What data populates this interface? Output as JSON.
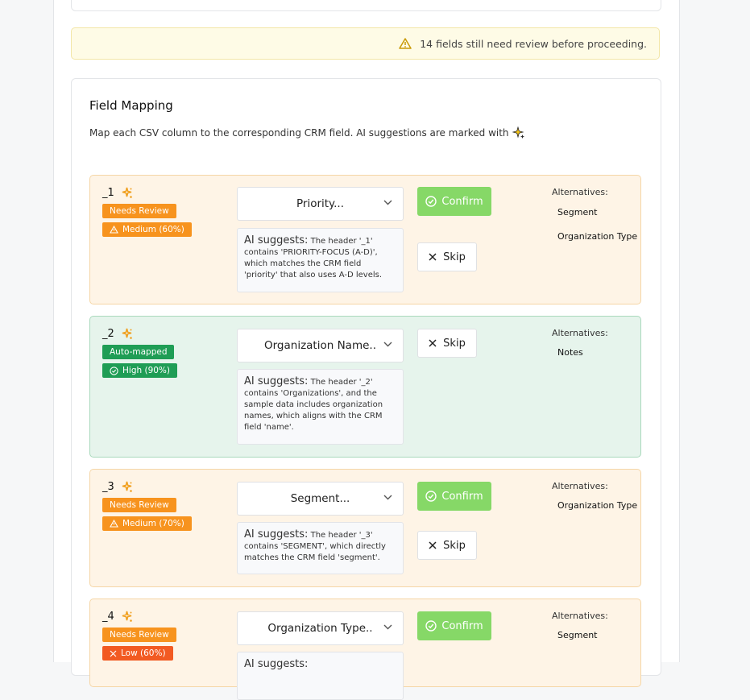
{
  "warning": {
    "text": "14 fields still need review before proceeding."
  },
  "mapping": {
    "title": "Field Mapping",
    "subtitle": "Map each CSV column to the corresponding CRM field. AI suggestions are marked with"
  },
  "ui": {
    "alternatives_label": "Alternatives:",
    "ai_label": "AI suggests:",
    "confirm_label": "Confirm",
    "skip_label": "Skip"
  },
  "rows": [
    {
      "field": "_1",
      "status": "Needs Review",
      "confidence": "Medium (60%)",
      "selected": "Priority...",
      "suggestion": "The header '_1' contains 'PRIORITY-FOCUS (A-D)', which matches the CRM field 'priority' that also uses A-D levels.",
      "alternatives": [
        "Segment",
        "Organization Type"
      ]
    },
    {
      "field": "_2",
      "status": "Auto-mapped",
      "confidence": "High (90%)",
      "selected": "Organization Name..",
      "suggestion": "The header '_2' contains 'Organizations', and the sample data includes organization names, which aligns with the CRM field 'name'.",
      "alternatives": [
        "Notes"
      ]
    },
    {
      "field": "_3",
      "status": "Needs Review",
      "confidence": "Medium (70%)",
      "selected": "Segment...",
      "suggestion": "The header '_3' contains 'SEGMENT', which directly matches the CRM field 'segment'.",
      "alternatives": [
        "Organization Type"
      ]
    },
    {
      "field": "_4",
      "status": "Needs Review",
      "confidence": "Low (60%)",
      "selected": "Organization Type..",
      "suggestion": "",
      "alternatives": [
        "Segment"
      ]
    }
  ]
}
